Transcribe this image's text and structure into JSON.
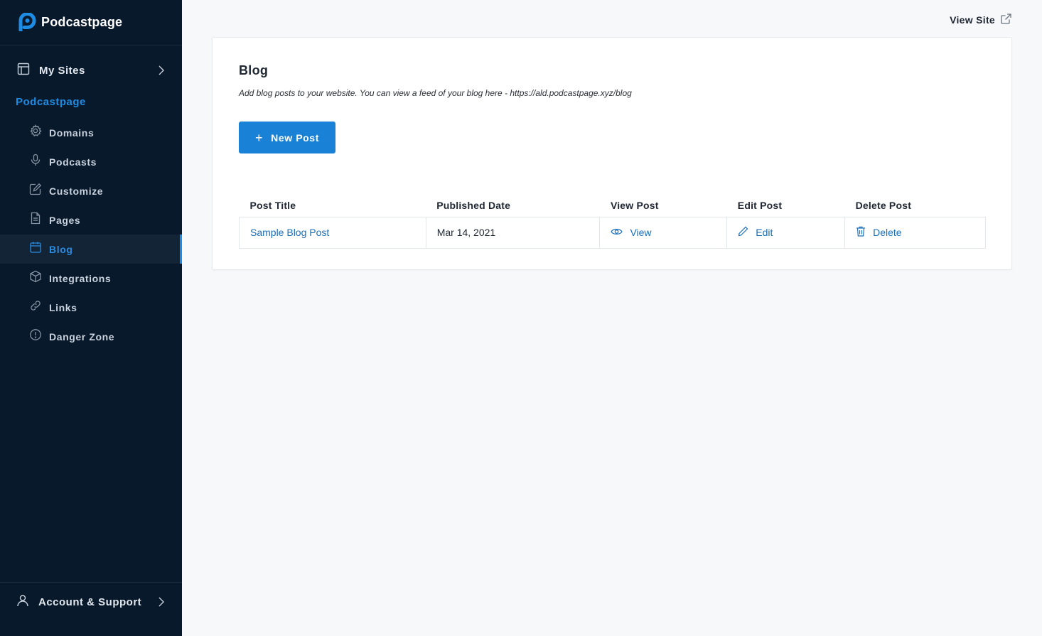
{
  "app": {
    "brand": "Podcastpage"
  },
  "sidebar": {
    "my_sites": "My Sites",
    "section_title": "Podcastpage",
    "items": [
      {
        "label": "Domains",
        "icon": "gear-icon"
      },
      {
        "label": "Podcasts",
        "icon": "microphone-icon"
      },
      {
        "label": "Customize",
        "icon": "edit-icon"
      },
      {
        "label": "Pages",
        "icon": "page-icon"
      },
      {
        "label": "Blog",
        "icon": "calendar-icon",
        "active": true
      },
      {
        "label": "Integrations",
        "icon": "cube-icon"
      },
      {
        "label": "Links",
        "icon": "link-icon"
      },
      {
        "label": "Danger Zone",
        "icon": "alert-icon"
      }
    ],
    "account": "Account & Support"
  },
  "header": {
    "view_site": "View Site"
  },
  "main": {
    "title": "Blog",
    "description": "Add blog posts to your website. You can view a feed of your blog here - https://ald.podcastpage.xyz/blog",
    "new_post_label": "New Post",
    "table": {
      "headers": [
        "Post Title",
        "Published Date",
        "View Post",
        "Edit Post",
        "Delete Post"
      ],
      "rows": [
        {
          "title": "Sample Blog Post",
          "date": "Mar 14, 2021",
          "view": "View",
          "edit": "Edit",
          "delete": "Delete"
        }
      ]
    }
  },
  "colors": {
    "sidebar_bg": "#08192b",
    "accent": "#1a82d6",
    "link": "#1a6fb8",
    "page_bg": "#f7f8fa"
  }
}
